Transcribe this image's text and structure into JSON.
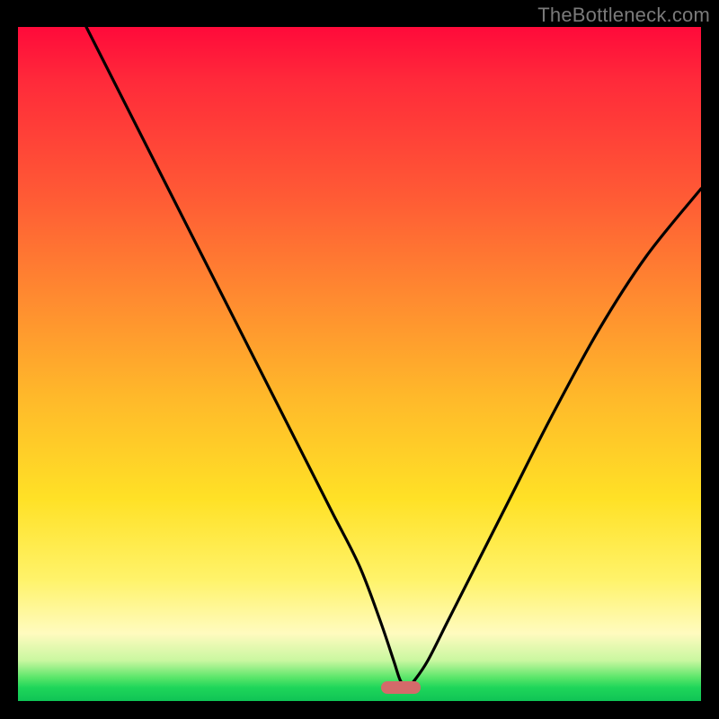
{
  "watermark": "TheBottleneck.com",
  "colors": {
    "curve": "#000000",
    "marker": "#d46a6a",
    "gradient_top": "#ff0a3a",
    "gradient_bottom": "#0fc455"
  },
  "chart_data": {
    "type": "line",
    "title": "",
    "xlabel": "",
    "ylabel": "",
    "xlim": [
      0,
      100
    ],
    "ylim": [
      0,
      100
    ],
    "grid": false,
    "legend": false,
    "annotations": [
      {
        "kind": "marker",
        "shape": "rounded-bar",
        "x": 56,
        "y": 2,
        "color": "#d46a6a"
      }
    ],
    "series": [
      {
        "name": "curve",
        "color": "#000000",
        "x": [
          10,
          14,
          18,
          22,
          26,
          30,
          34,
          38,
          42,
          46,
          50,
          53,
          55,
          56,
          57,
          58,
          60,
          63,
          67,
          72,
          78,
          85,
          92,
          100
        ],
        "values": [
          100,
          92,
          84,
          76,
          68,
          60,
          52,
          44,
          36,
          28,
          20,
          12,
          6,
          3,
          2,
          3,
          6,
          12,
          20,
          30,
          42,
          55,
          66,
          76
        ]
      }
    ]
  }
}
